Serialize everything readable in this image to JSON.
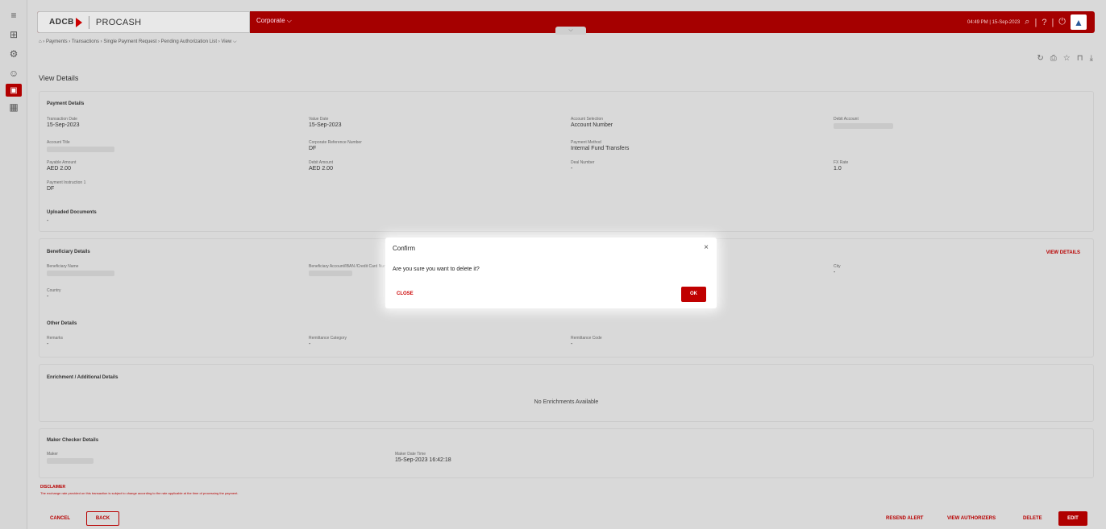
{
  "side_rail": {
    "icons": [
      "menu-icon",
      "dashboard-icon",
      "settings-icon",
      "user-icon",
      "payments-icon",
      "reports-icon"
    ]
  },
  "header": {
    "logo_text": "ADCB",
    "app_name": "PROCASH",
    "segment_label": "Corporate ⌵",
    "datetime": "04:49 PM | 15-Sep-2023",
    "collapse_glyph": "⌵"
  },
  "breadcrumb": {
    "text": "⌂ › Payments › Transactions › Single Payment Request › Pending Authorization List › View ⌵"
  },
  "page_tools": {
    "icons": [
      "refresh-icon",
      "print-icon",
      "star-icon",
      "bookmark-icon",
      "download-icon"
    ]
  },
  "page": {
    "title": "View Details"
  },
  "payment_details": {
    "section_title": "Payment Details",
    "transaction_date_label": "Transaction Date",
    "transaction_date": "15-Sep-2023",
    "value_date_label": "Value Date",
    "value_date": "15-Sep-2023",
    "account_selection_label": "Account Selection",
    "account_selection": "Account Number",
    "debit_account_label": "Debit Account",
    "account_title_label": "Account Title",
    "corp_ref_label": "Corporate Reference Number",
    "corp_ref": "DF",
    "payment_method_label": "Payment Method",
    "payment_method": "Internal Fund Transfers",
    "payable_amount_label": "Payable Amount",
    "payable_amount": "AED 2.00",
    "debit_amount_label": "Debit Amount",
    "debit_amount": "AED 2.00",
    "deal_number_label": "Deal Number",
    "deal_number": "-",
    "fx_rate_label": "FX Rate",
    "fx_rate": "1.0",
    "instruction_label": "Payment Instruction 1",
    "instruction": "DF",
    "uploaded_docs_label": "Uploaded Documents",
    "uploaded_docs": "-"
  },
  "beneficiary_details": {
    "section_title": "Beneficiary Details",
    "view_details_link": "VIEW DETAILS",
    "name_label": "Beneficiary Name",
    "account_label": "Beneficiary Account/IBAN /Credit Card Number",
    "city_label": "City",
    "city": "-",
    "country_label": "Country",
    "country": "-"
  },
  "other_details": {
    "section_title": "Other Details",
    "remarks_label": "Remarks",
    "remarks": "-",
    "remittance_category_label": "Remittance Category",
    "remittance_category": "-",
    "remittance_code_label": "Remittance Code",
    "remittance_code": "-"
  },
  "enrichment": {
    "section_title": "Enrichment / Additional Details",
    "empty_message": "No Enrichments Available"
  },
  "maker_checker": {
    "section_title": "Maker Checker Details",
    "maker_label": "Maker",
    "maker_datetime_label": "Maker Date Time",
    "maker_datetime": "15-Sep-2023 16:42:18"
  },
  "disclaimer": {
    "title": "DISCLAIMER",
    "text": "The exchange rate provided on this transaction is subject to change according to the rate applicable at the time of processing the payment."
  },
  "actions": {
    "cancel": "CANCEL",
    "back": "BACK",
    "resend_alert": "RESEND ALERT",
    "view_authorizers": "VIEW AUTHORIZERS",
    "delete": "DELETE",
    "edit": "EDIT"
  },
  "modal": {
    "title": "Confirm",
    "close_glyph": "×",
    "message": "Are you sure you want to delete it?",
    "close_button": "CLOSE",
    "ok_button": "OK"
  },
  "colors": {
    "brand_red": "#a50000",
    "accent_red": "#b80000"
  }
}
